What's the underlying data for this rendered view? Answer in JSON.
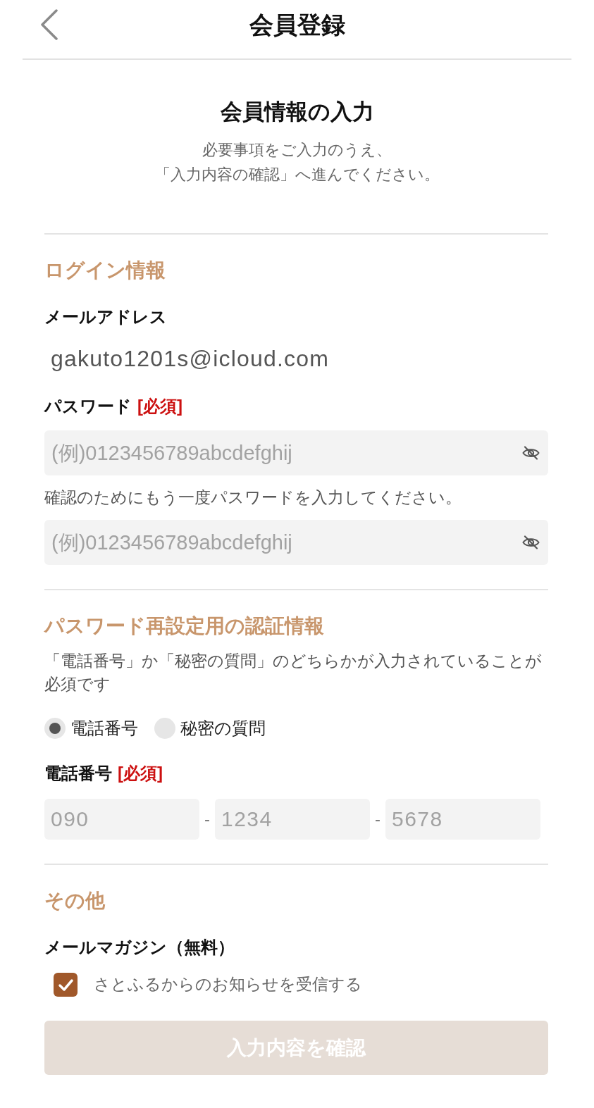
{
  "header": {
    "title": "会員登録"
  },
  "intro": {
    "title": "会員情報の入力",
    "lines": [
      "必要事項をご入力のうえ、",
      "「入力内容の確認」へ進んでください。"
    ]
  },
  "sections": [
    {
      "heading": "ログイン情報",
      "items": [
        {
          "kind": "label",
          "text": "メールアドレス"
        },
        {
          "kind": "value",
          "text": "gakuto1201s@icloud.com"
        },
        {
          "kind": "label",
          "text": "パスワード",
          "required": "[必須]"
        },
        {
          "kind": "password",
          "placeholder": "(例)0123456789abcdefghij"
        },
        {
          "kind": "note",
          "text": "確認のためにもう一度パスワードを入力してください。"
        },
        {
          "kind": "password",
          "placeholder": "(例)0123456789abcdefghij"
        }
      ]
    },
    {
      "heading": "パスワード再設定用の認証情報",
      "items": [
        {
          "kind": "note",
          "text": "「電話番号」か「秘密の質問」のどちらかが入力されていることが必須です"
        },
        {
          "kind": "radios",
          "options": [
            {
              "label": "電話番号",
              "selected": true
            },
            {
              "label": "秘密の質問",
              "selected": false
            }
          ]
        },
        {
          "kind": "label",
          "text": "電話番号",
          "required": "[必須]"
        },
        {
          "kind": "phone",
          "parts": [
            {
              "placeholder": "090"
            },
            {
              "separator": "-",
              "placeholder": "1234"
            },
            {
              "separator": "-",
              "placeholder": "5678"
            }
          ]
        }
      ]
    },
    {
      "heading": "その他",
      "items": [
        {
          "kind": "label",
          "text": "メールマガジン（無料）"
        },
        {
          "kind": "checkbox",
          "label": "さとふるからのお知らせを受信する",
          "checked": true
        }
      ]
    }
  ],
  "submit": {
    "label": "入力内容を確認",
    "disabled": true
  }
}
